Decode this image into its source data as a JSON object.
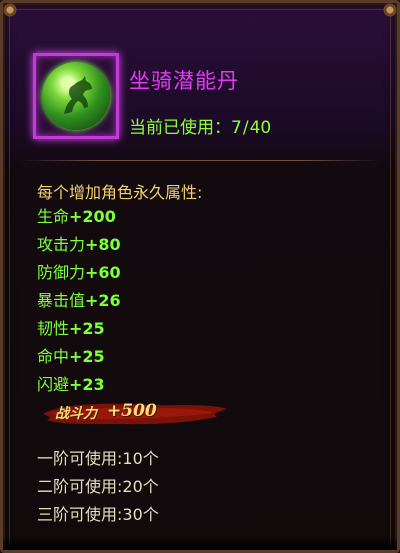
{
  "item": {
    "name": "坐骑潜能丹",
    "icon": "horse-orb-icon",
    "usage_label": "当前已使用：",
    "usage_current": "7",
    "usage_max": "40"
  },
  "attributes": {
    "title": "每个增加角色永久属性:",
    "list": [
      {
        "name": "生命",
        "value": "+200"
      },
      {
        "name": "攻击力",
        "value": "+80"
      },
      {
        "name": "防御力",
        "value": "+60"
      },
      {
        "name": "暴击值",
        "value": "+26"
      },
      {
        "name": "韧性",
        "value": "+25"
      },
      {
        "name": "命中",
        "value": "+25"
      },
      {
        "name": "闪避",
        "value": "+23"
      }
    ]
  },
  "battle_power": {
    "label": "战斗力",
    "value": "+500"
  },
  "tiers": [
    "一阶可使用:10个",
    "二阶可使用:20个",
    "三阶可使用:30个"
  ],
  "colors": {
    "name": "#e23cf2",
    "usage": "#8dff3a",
    "stat": "#7dff3a",
    "section_title": "#f3d36b",
    "tier_text": "#e8ddbf",
    "icon_border": "#c23ad8"
  }
}
